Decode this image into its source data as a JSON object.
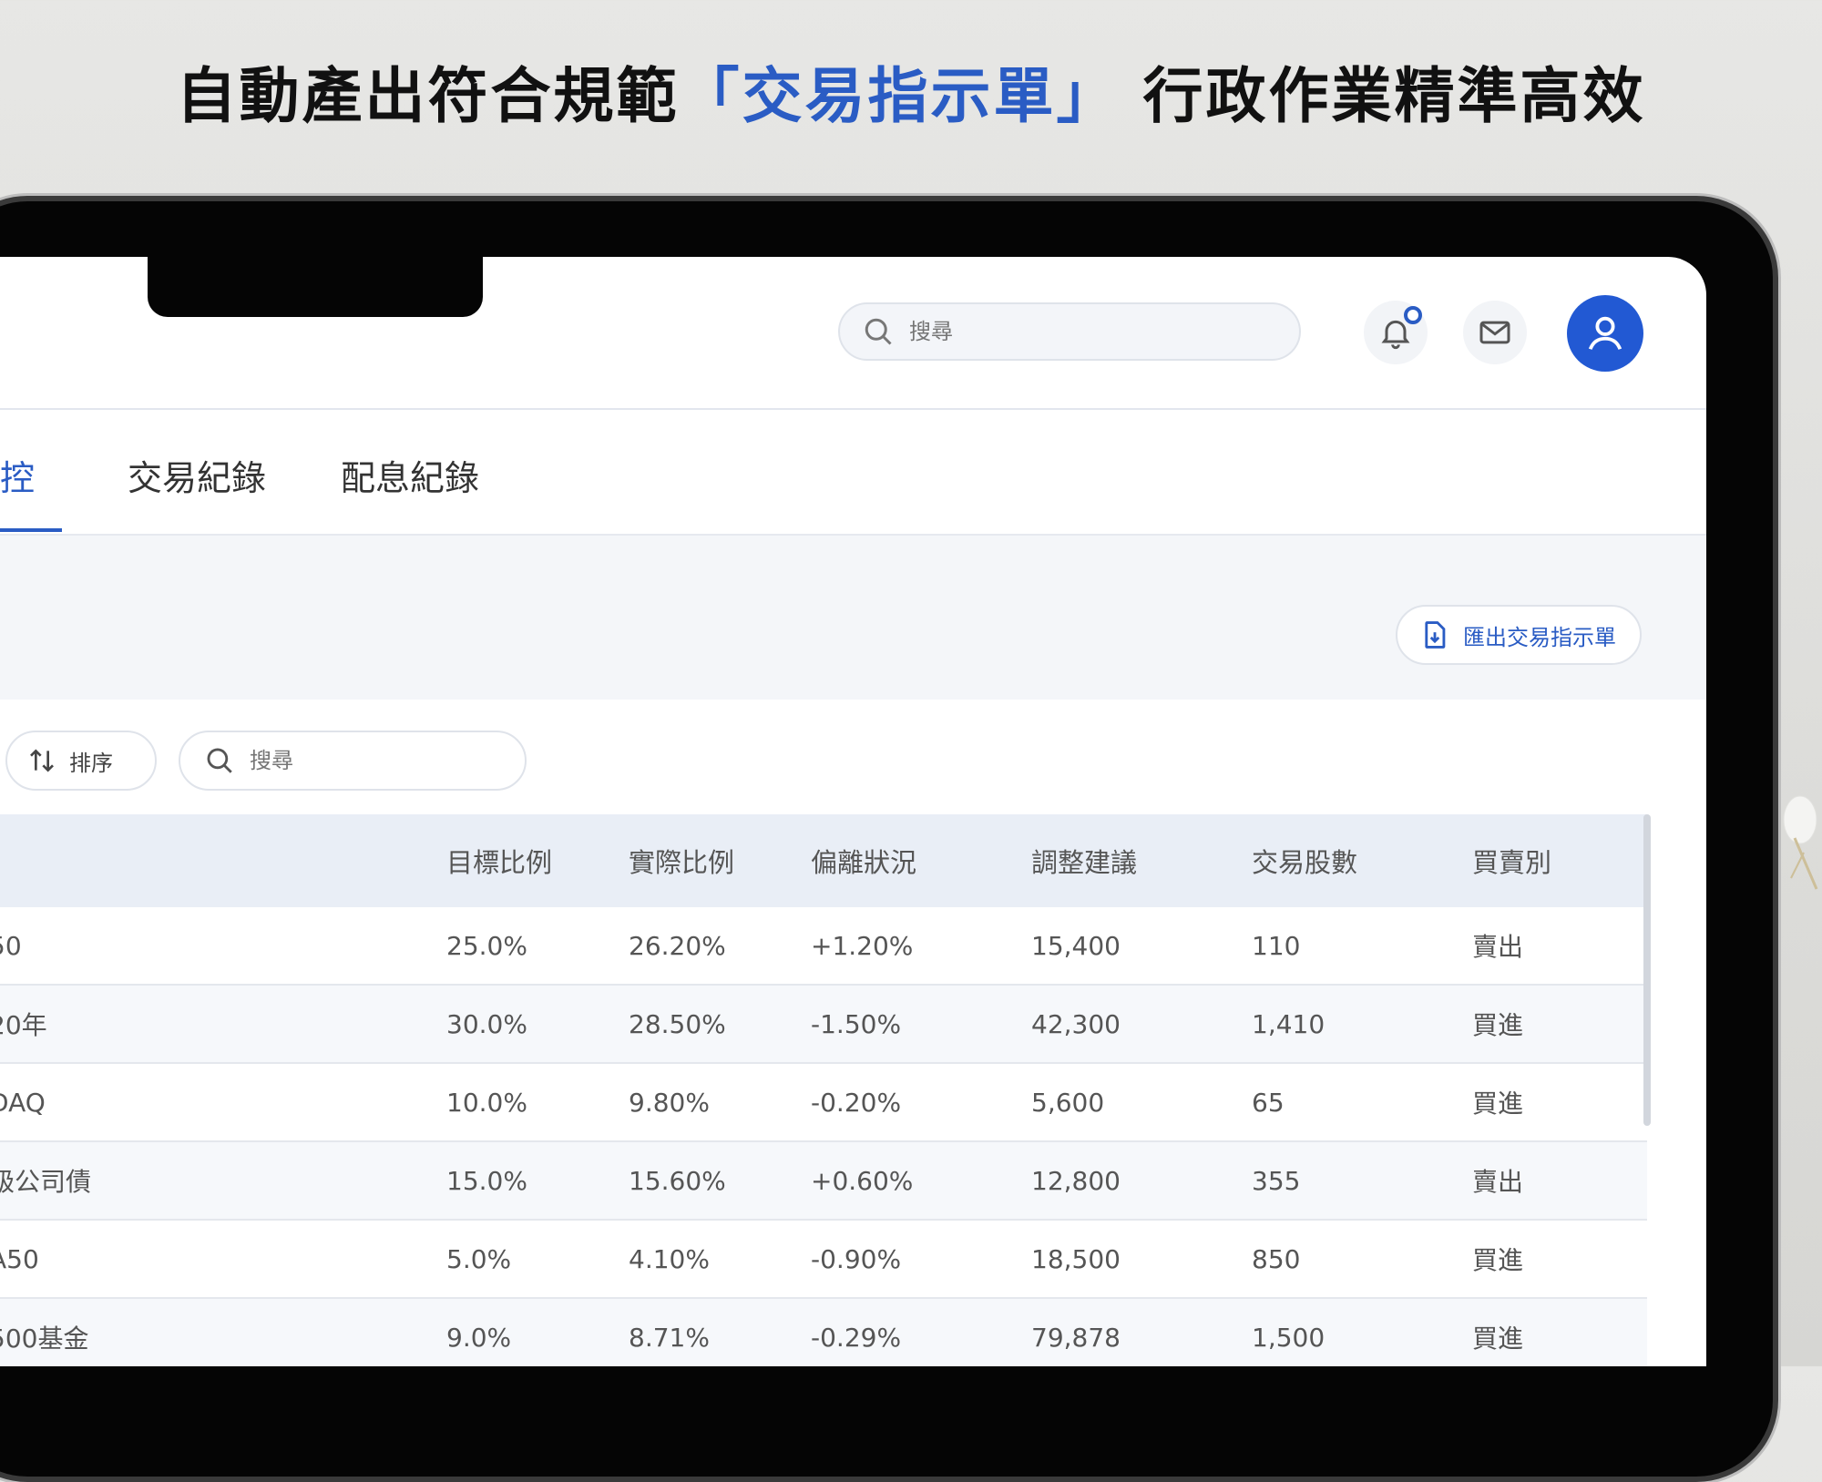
{
  "headline": {
    "pre": "自動產出符合規範",
    "accent": "「交易指示單」",
    "post": " 行政作業精準高效"
  },
  "colors": {
    "accent": "#2a5cc4",
    "avatar": "#2259d3"
  },
  "topbar": {
    "search_placeholder": "搜尋",
    "icons": [
      "search-icon",
      "bell-icon",
      "mail-icon",
      "user-icon"
    ]
  },
  "tabs": [
    {
      "label": "監控",
      "active": true
    },
    {
      "label": "交易紀錄",
      "active": false
    },
    {
      "label": "配息紀錄",
      "active": false
    }
  ],
  "actions": {
    "export_label": "匯出交易指示單"
  },
  "toolbar": {
    "sort_label": "排序",
    "search_placeholder": "搜尋"
  },
  "table": {
    "headers": [
      "",
      "目標比例",
      "實際比例",
      "偏離狀況",
      "調整建議",
      "交易股數",
      "買賣別"
    ],
    "rows": [
      [
        "50",
        "25.0%",
        "26.20%",
        "+1.20%",
        "15,400",
        "110",
        "賣出"
      ],
      [
        "20年",
        "30.0%",
        "28.50%",
        "-1.50%",
        "42,300",
        "1,410",
        "買進"
      ],
      [
        "DAQ",
        "10.0%",
        "9.80%",
        "-0.20%",
        "5,600",
        "65",
        "買進"
      ],
      [
        "級公司債",
        "15.0%",
        "15.60%",
        "+0.60%",
        "12,800",
        "355",
        "賣出"
      ],
      [
        "A50",
        "5.0%",
        "4.10%",
        "-0.90%",
        "18,500",
        "850",
        "買進"
      ],
      [
        "500基金",
        "9.0%",
        "8.71%",
        "-0.29%",
        "79,878",
        "1,500",
        "買進"
      ]
    ]
  }
}
